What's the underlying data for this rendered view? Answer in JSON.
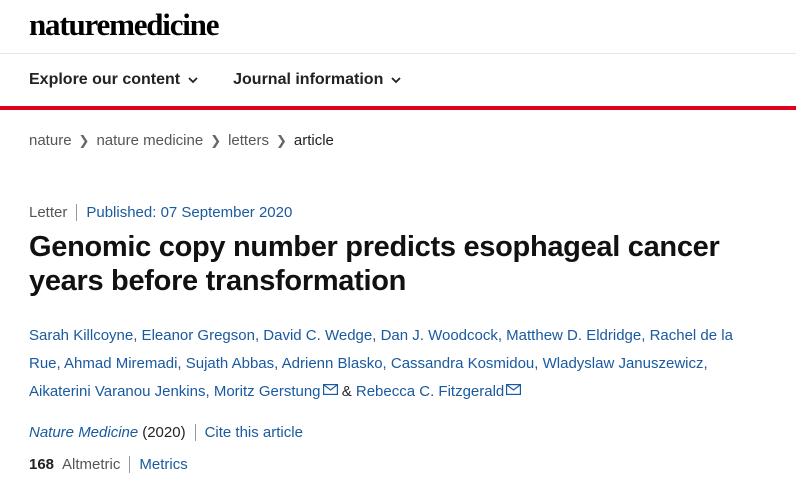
{
  "header": {
    "logo_part1": "nature",
    "logo_part2": "medicine"
  },
  "nav": {
    "items": [
      {
        "label": "Explore our content"
      },
      {
        "label": "Journal information"
      }
    ]
  },
  "colors": {
    "accent_red": "#e0001a",
    "link_blue": "#1a5aa0"
  },
  "breadcrumb": {
    "items": [
      "nature",
      "nature medicine",
      "letters",
      "article"
    ]
  },
  "article": {
    "type": "Letter",
    "published": "Published: 07 September 2020",
    "title": "Genomic copy number predicts esophageal cancer years before transformation",
    "authors_line1": "Sarah Killcoyne, Eleanor Gregson, David C. Wedge, Dan J. Woodcock, Matthew D. Eldridge, Rachel de la",
    "authors_line2": "Rue, Ahmad Miremadi, Sujath Abbas, Adrienn Blasko, Cassandra Kosmidou, Wladyslaw Januszewicz,",
    "authors_line3_a": "Aikaterini Varanou Jenkins, Moritz Gerstung",
    "authors_amp": " & ",
    "authors_line3_b": "Rebecca C. Fitzgerald",
    "journal": "Nature Medicine",
    "year": "(2020)",
    "cite_label": "Cite this article",
    "altmetric_count": "168",
    "altmetric_label": "Altmetric",
    "metrics_label": "Metrics"
  }
}
